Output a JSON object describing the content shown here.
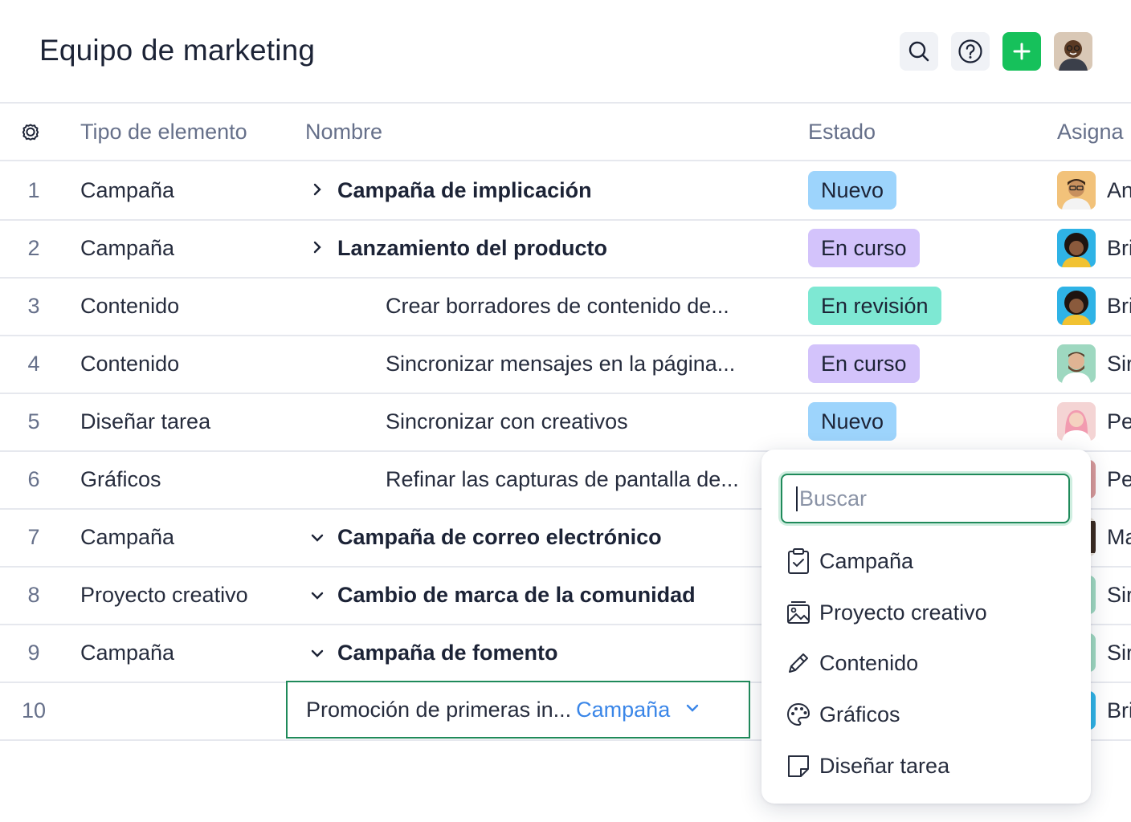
{
  "header": {
    "title": "Equipo de marketing"
  },
  "table": {
    "columns": {
      "type": "Tipo de elemento",
      "name": "Nombre",
      "status": "Estado",
      "assignee": "Asigna"
    },
    "rows": [
      {
        "num": "1",
        "type": "Campaña",
        "name": "Campaña de implicación",
        "status": "Nuevo",
        "assignee": "An"
      },
      {
        "num": "2",
        "type": "Campaña",
        "name": "Lanzamiento del producto",
        "status": "En curso",
        "assignee": "Bri"
      },
      {
        "num": "3",
        "type": "Contenido",
        "name": "Crear borradores de contenido de...",
        "status": "En revisión",
        "assignee": "Bri"
      },
      {
        "num": "4",
        "type": "Contenido",
        "name": "Sincronizar mensajes en la página...",
        "status": "En curso",
        "assignee": "Sir"
      },
      {
        "num": "5",
        "type": "Diseñar tarea",
        "name": "Sincronizar con creativos",
        "status": "Nuevo",
        "assignee": "Pe"
      },
      {
        "num": "6",
        "type": "Gráficos",
        "name": "Refinar las capturas de pantalla de...",
        "assignee": "Pe"
      },
      {
        "num": "7",
        "type": "Campaña",
        "name": "Campaña de correo electrónico",
        "assignee": "Ma"
      },
      {
        "num": "8",
        "type": "Proyecto creativo",
        "name": "Cambio de marca de la comunidad",
        "assignee": "Sir"
      },
      {
        "num": "9",
        "type": "Campaña",
        "name": "Campaña de fomento",
        "assignee": "Sir"
      },
      {
        "num": "10",
        "name": "Promoción de primeras in...",
        "type_tag": "Campaña",
        "assignee": "Bri"
      }
    ]
  },
  "status_colors": {
    "Nuevo": "#9dd4fc",
    "En curso": "#d3c3fb",
    "En revisión": "#7ee8d3"
  },
  "accent_color": "#1f8a5a",
  "dropdown": {
    "search_placeholder": "Buscar",
    "options": [
      {
        "label": "Campaña",
        "icon": "clipboard-check-icon"
      },
      {
        "label": "Proyecto creativo",
        "icon": "image-icon"
      },
      {
        "label": "Contenido",
        "icon": "pencil-icon"
      },
      {
        "label": "Gráficos",
        "icon": "palette-icon"
      },
      {
        "label": "Diseñar tarea",
        "icon": "note-icon"
      }
    ]
  }
}
